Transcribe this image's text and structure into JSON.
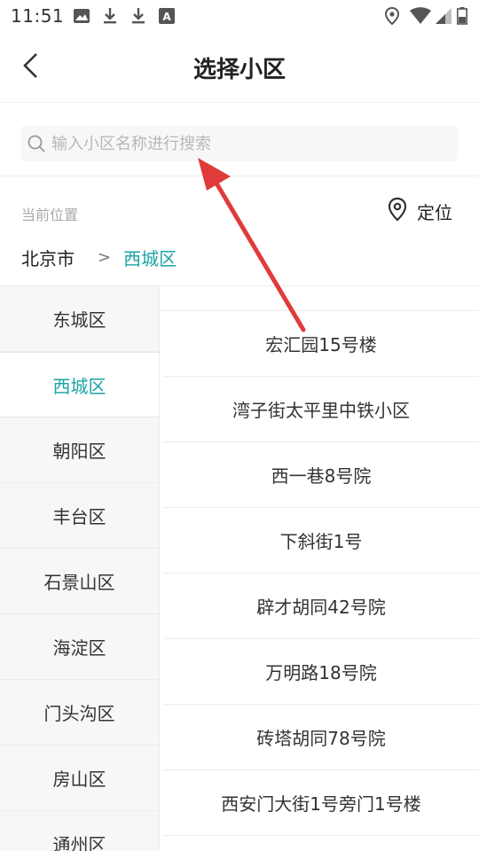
{
  "status_bar": {
    "time": "11:51",
    "left_icons": [
      "image-icon",
      "download-icon",
      "download-icon",
      "font-icon"
    ],
    "right_icons": [
      "location-icon",
      "wifi-icon",
      "signal-icon",
      "battery-icon"
    ]
  },
  "header": {
    "title": "选择小区",
    "back_icon": "chevron-left-icon"
  },
  "search": {
    "placeholder": "输入小区名称进行搜索",
    "value": ""
  },
  "location": {
    "label": "当前位置",
    "locate_label": "定位",
    "city": "北京市",
    "separator": ">",
    "district": "西城区"
  },
  "districts": [
    {
      "name": "东城区",
      "selected": false
    },
    {
      "name": "西城区",
      "selected": true
    },
    {
      "name": "朝阳区",
      "selected": false
    },
    {
      "name": "丰台区",
      "selected": false
    },
    {
      "name": "石景山区",
      "selected": false
    },
    {
      "name": "海淀区",
      "selected": false
    },
    {
      "name": "门头沟区",
      "selected": false
    },
    {
      "name": "房山区",
      "selected": false
    },
    {
      "name": "通州区",
      "selected": false
    }
  ],
  "communities": [
    "宏汇园15号楼",
    "湾子街太平里中铁小区",
    "西一巷8号院",
    "下斜街1号",
    "辟才胡同42号院",
    "万明路18号院",
    "砖塔胡同78号院",
    "西安门大街1号旁门1号楼"
  ],
  "colors": {
    "accent": "#1aa3a3",
    "annotation_arrow": "#e03b3b"
  }
}
